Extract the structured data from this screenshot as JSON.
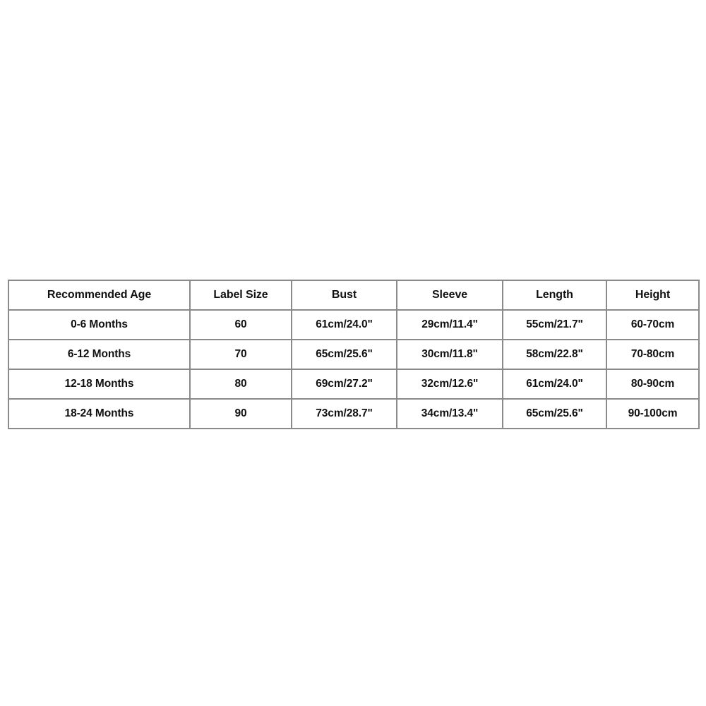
{
  "page": {
    "background_color": "#ffffff",
    "text_color": "#111111",
    "border_color": "#8a8a8a"
  },
  "size_chart": {
    "columns": [
      {
        "key": "recommended_age",
        "label": "Recommended Age"
      },
      {
        "key": "label_size",
        "label": "Label Size"
      },
      {
        "key": "bust",
        "label": "Bust"
      },
      {
        "key": "sleeve",
        "label": "Sleeve"
      },
      {
        "key": "length",
        "label": "Length"
      },
      {
        "key": "height",
        "label": "Height"
      }
    ],
    "rows": [
      {
        "recommended_age": "0-6 Months",
        "label_size": "60",
        "bust": "61cm/24.0\"",
        "sleeve": "29cm/11.4\"",
        "length": "55cm/21.7\"",
        "height": "60-70cm"
      },
      {
        "recommended_age": "6-12 Months",
        "label_size": "70",
        "bust": "65cm/25.6\"",
        "sleeve": "30cm/11.8\"",
        "length": "58cm/22.8\"",
        "height": "70-80cm"
      },
      {
        "recommended_age": "12-18 Months",
        "label_size": "80",
        "bust": "69cm/27.2\"",
        "sleeve": "32cm/12.6\"",
        "length": "61cm/24.0\"",
        "height": "80-90cm"
      },
      {
        "recommended_age": "18-24 Months",
        "label_size": "90",
        "bust": "73cm/28.7\"",
        "sleeve": "34cm/13.4\"",
        "length": "65cm/25.6\"",
        "height": "90-100cm"
      }
    ]
  },
  "chart_data": {
    "type": "table",
    "title": "",
    "columns": [
      "Recommended Age",
      "Label Size",
      "Bust",
      "Sleeve",
      "Length",
      "Height"
    ],
    "data": [
      [
        "0-6 Months",
        "60",
        "61cm/24.0\"",
        "29cm/11.4\"",
        "55cm/21.7\"",
        "60-70cm"
      ],
      [
        "6-12 Months",
        "70",
        "65cm/25.6\"",
        "30cm/11.8\"",
        "58cm/22.8\"",
        "70-80cm"
      ],
      [
        "12-18 Months",
        "80",
        "69cm/27.2\"",
        "32cm/12.6\"",
        "61cm/24.0\"",
        "80-90cm"
      ],
      [
        "18-24 Months",
        "90",
        "73cm/28.7\"",
        "34cm/13.4\"",
        "65cm/25.6\"",
        "90-100cm"
      ]
    ]
  }
}
